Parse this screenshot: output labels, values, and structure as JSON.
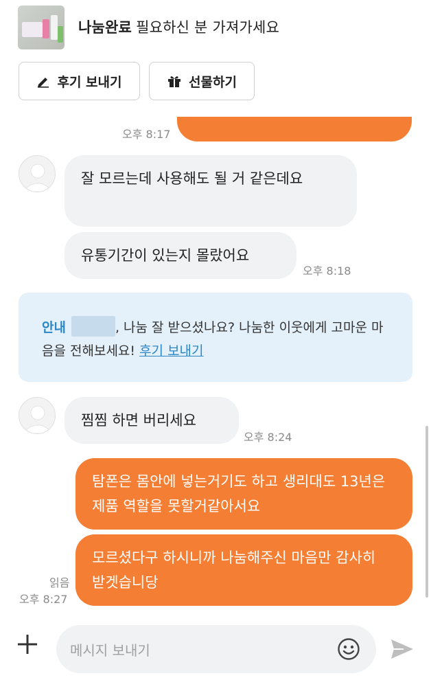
{
  "header": {
    "status_label": "나눔완료",
    "title": "필요하신 분 가져가세요",
    "review_button": "후기 보내기",
    "gift_button": "선물하기"
  },
  "messages": {
    "partial_out_time": "오후 8:17",
    "in_1_text": "잘 모르는데 사용해도 될 거 같은데요",
    "in_2_text": "유통기간이 있는지 몰랐어요",
    "in_2_time": "오후 8:18",
    "in_3_text": "찜찜 하면  버리세요",
    "in_3_time": "오후 8:24",
    "out_1_text": "탐폰은 몸안에 넣는거기도 하고 생리대도 13년은 제품 역할을 못할거같아서요",
    "out_2_text": "모르셨다구 하시니까 나눔해주신 마음만 감사히 받겟습니당",
    "out_read": "읽음",
    "out_time": "오후 8:27"
  },
  "notice": {
    "tag": "안내",
    "text_a": ", 나눔 잘 받으셨나요? 나눔한 이웃에게 고마운 마음을 전해보세요!",
    "link": "후기 보내기"
  },
  "input": {
    "placeholder": "메시지 보내기"
  },
  "colors": {
    "accent": "#f47e33",
    "incoming_bubble": "#f1f2f4",
    "notice_bg": "#e4f1fb",
    "link": "#2b86c5"
  },
  "icons": [
    "pencil-icon",
    "gift-icon",
    "plus-icon",
    "smile-icon",
    "send-icon"
  ]
}
